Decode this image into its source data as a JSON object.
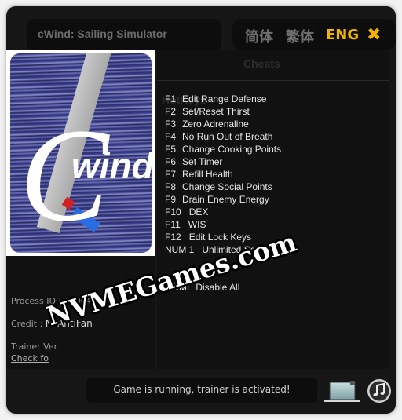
{
  "window": {
    "title": "cWind: Sailing Simulator"
  },
  "languages": {
    "simplified_chinese": "简体",
    "traditional_chinese": "繁体",
    "english": "ENG",
    "active": "ENG",
    "accent_color": "#f0b400"
  },
  "close_icon": "✖",
  "cover": {
    "logo_c": "C",
    "logo_text": "wind"
  },
  "info": {
    "process_id_label": "Process ID : ",
    "process_id_value": "12064",
    "credit_label": "Credit :  ",
    "credit_value": "MrAntiFan",
    "trainer_version_label": "Trainer Ver",
    "check_update_label": "Check fo"
  },
  "tabs": {
    "hotkeys": "HotKeys",
    "cheats": "Cheats"
  },
  "hotkeys": [
    {
      "key": "F1",
      "action": "Edit Range Defense"
    },
    {
      "key": "F2",
      "action": "Set/Reset Thirst"
    },
    {
      "key": "F3",
      "action": "Zero Adrenaline"
    },
    {
      "key": "F4",
      "action": "No Run Out of Breath"
    },
    {
      "key": "F5",
      "action": "Change Cooking Points"
    },
    {
      "key": "F6",
      "action": "Set Timer"
    },
    {
      "key": "F7",
      "action": "Refill Health"
    },
    {
      "key": "F8",
      "action": "Change Social Points"
    },
    {
      "key": "F9",
      "action": "Drain Enemy Energy"
    },
    {
      "key": "F10",
      "action": "DEX"
    },
    {
      "key": "F11",
      "action": "WIS"
    },
    {
      "key": "F12",
      "action": "Edit Lock Keys"
    },
    {
      "key": "NUM 1",
      "action": "Unlimited Sols"
    }
  ],
  "disable_all": "HOME Disable All",
  "status": {
    "message": "Game is running, trainer is activated!"
  },
  "watermark": "NVMEGames.com"
}
